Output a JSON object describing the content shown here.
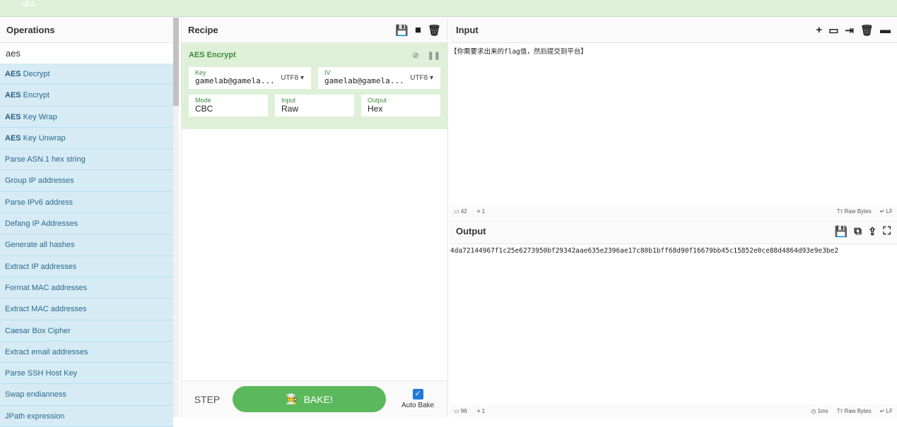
{
  "topbar": {
    "lang_icon": "中A"
  },
  "operations": {
    "title": "Operations",
    "search_value": "aes",
    "items": [
      {
        "match": "AES",
        "rest": " Decrypt"
      },
      {
        "match": "AES",
        "rest": " Encrypt"
      },
      {
        "match": "AES",
        "rest": " Key Wrap"
      },
      {
        "match": "AES",
        "rest": " Key Unwrap"
      },
      {
        "match": "",
        "rest": "Parse ASN.1 hex string"
      },
      {
        "match": "",
        "rest": "Group IP addresses"
      },
      {
        "match": "",
        "rest": "Parse IPv6 address"
      },
      {
        "match": "",
        "rest": "Defang IP Addresses"
      },
      {
        "match": "",
        "rest": "Generate all hashes"
      },
      {
        "match": "",
        "rest": "Extract IP addresses"
      },
      {
        "match": "",
        "rest": "Format MAC addresses"
      },
      {
        "match": "",
        "rest": "Extract MAC addresses"
      },
      {
        "match": "",
        "rest": "Caesar Box Cipher"
      },
      {
        "match": "",
        "rest": "Extract email addresses"
      },
      {
        "match": "",
        "rest": "Parse SSH Host Key"
      },
      {
        "match": "",
        "rest": "Swap endianness"
      },
      {
        "match": "",
        "rest": "JPath expression"
      }
    ]
  },
  "recipe": {
    "title": "Recipe",
    "op": {
      "title": "AES Encrypt",
      "key": {
        "label": "Key",
        "value": "gamelab@gamela...",
        "encoding": "UTF8"
      },
      "iv": {
        "label": "IV",
        "value": "gamelab@gamela...",
        "encoding": "UTF8"
      },
      "mode": {
        "label": "Mode",
        "value": "CBC"
      },
      "input": {
        "label": "Input",
        "value": "Raw"
      },
      "output": {
        "label": "Output",
        "value": "Hex"
      }
    },
    "step_label": "STEP",
    "bake_label": "BAKE!",
    "auto_bake_label": "Auto Bake",
    "auto_bake": true
  },
  "input": {
    "title": "Input",
    "text": "【你需要求出来的flag值，然后提交到平台】",
    "length": "42",
    "lines": "1",
    "format": "Raw Bytes",
    "eol": "LF"
  },
  "output": {
    "title": "Output",
    "text": "4da72144967f1c25e6273950bf29342aae635e2396ae17c80b1bff68d90f16679bb45c15852e0ce88d4864d93e9e3be2",
    "length": "96",
    "lines": "1",
    "time": "1ms",
    "format": "Raw Bytes",
    "eol": "LF"
  },
  "colors": {
    "accent_green": "#5cb85c",
    "ops_bg": "#d6ebf4",
    "recipe_bg": "#dff0d8"
  }
}
